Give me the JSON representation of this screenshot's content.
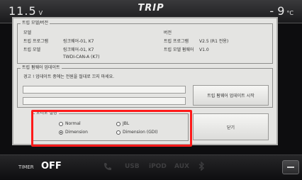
{
  "status": {
    "voltage": "11.5",
    "voltage_unit": "V",
    "title": "TRIP",
    "temperature": "- 9",
    "temperature_unit": "°C"
  },
  "model_version": {
    "group_label": "트립 모델/버전",
    "model_header": "모델",
    "version_header": "버전",
    "rows": [
      {
        "label": "트립 프로그램",
        "value": "링크웨어-01, K7",
        "vlabel": "트립 프로그램",
        "vvalue": "V2.5 (R1 전용)"
      },
      {
        "label": "트립 모델",
        "value": "링크웨어-01, K7",
        "vlabel": "트립 모델 펌웨어",
        "vvalue": "V1.0"
      }
    ],
    "extra": "TWDI-CAN-A (K7)"
  },
  "firmware": {
    "group_label": "트립 펌웨어 업데이트",
    "warning": "경고 ! 업데이트 중에는 전원을 절대로 끄지 마세요.",
    "start_button": "트립 펌웨어 업데이트 시작"
  },
  "audio": {
    "group_label": "오디오 설정",
    "options": [
      {
        "label": "Normal",
        "selected": false
      },
      {
        "label": "JBL",
        "selected": false
      },
      {
        "label": "Dimension",
        "selected": true
      },
      {
        "label": "Dimension (GDI)",
        "selected": false
      }
    ]
  },
  "close_button": "닫기",
  "bottom": {
    "timer_label": "TIMER",
    "timer_value": "OFF",
    "sources": [
      "USB",
      "iPOD",
      "AUX"
    ]
  }
}
